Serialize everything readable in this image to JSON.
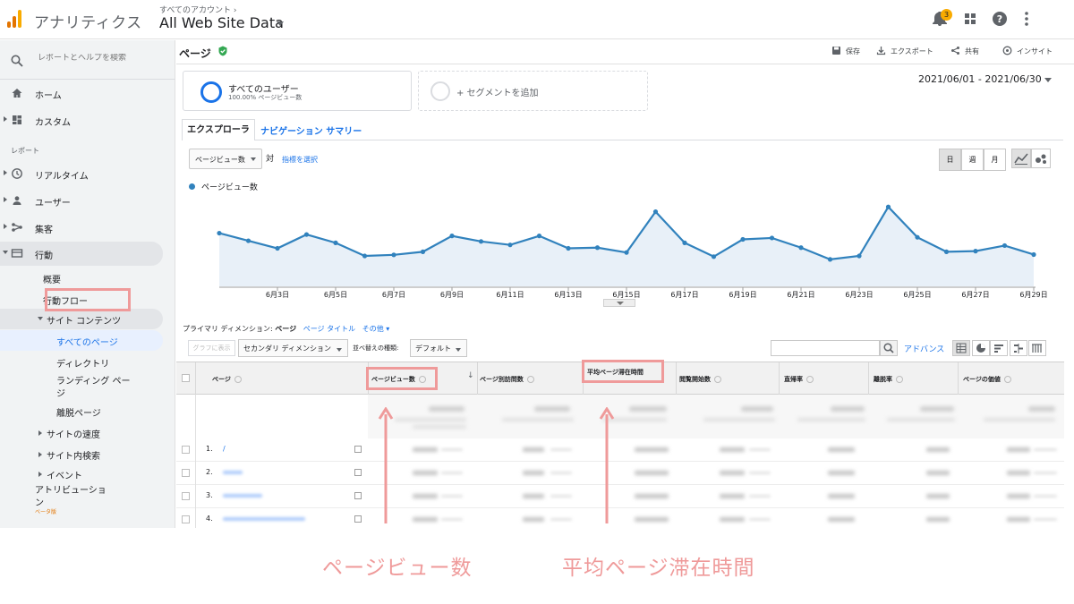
{
  "topbar": {
    "app_title": "アナリティクス",
    "account_crumb": "すべてのアカウント ›",
    "account_name": "All Web Site Data",
    "notification_count": "3",
    "icons": [
      "notifications-icon",
      "apps-icon",
      "help-icon",
      "more-vert-icon"
    ]
  },
  "sidebar": {
    "search_placeholder": "レポートとヘルプを検索",
    "items": [
      {
        "label": "ホーム",
        "icon": "home-icon"
      },
      {
        "label": "カスタム",
        "icon": "dashboard-icon"
      }
    ],
    "section_label": "レポート",
    "reports": [
      {
        "label": "リアルタイム",
        "icon": "clock-icon"
      },
      {
        "label": "ユーザー",
        "icon": "person-icon"
      },
      {
        "label": "集客",
        "icon": "acquisition-icon"
      },
      {
        "label": "行動",
        "icon": "behavior-icon"
      }
    ],
    "behavior_sub": {
      "overview": "概要",
      "flow": "行動フロー",
      "site_content": "サイト コンテンツ",
      "all_pages": "すべてのページ",
      "directory": "ディレクトリ",
      "landing_1": "ランディング ペー",
      "landing_2": "ジ",
      "exit_pages": "離脱ページ",
      "site_speed": "サイトの速度",
      "site_search": "サイト内検索",
      "events": "イベント"
    },
    "attribution_1": "アトリビューショ",
    "attribution_2": "ン",
    "beta": "ベータ版"
  },
  "header": {
    "page_title": "ページ",
    "tools": {
      "save": "保存",
      "export": "エクスポート",
      "share": "共有",
      "insight": "インサイト"
    }
  },
  "segment": {
    "name": "すべてのユーザー",
    "sub": "100.00% ページビュー数",
    "add": "+ セグメントを追加"
  },
  "date_range": "2021/06/01 - 2021/06/30",
  "tabs": {
    "explorer": "エクスプローラ",
    "nav_summary": "ナビゲーション サマリー"
  },
  "chart_controls": {
    "metric": "ページビュー数",
    "vs": "対",
    "select_metric": "指標を選択",
    "day": "日",
    "week": "週",
    "month": "月"
  },
  "chart_data": {
    "type": "area",
    "legend": "ページビュー数",
    "x": [
      "6月1日",
      "6月2日",
      "6月3日",
      "6月4日",
      "6月5日",
      "6月6日",
      "6月7日",
      "6月8日",
      "6月9日",
      "6月10日",
      "6月11日",
      "6月12日",
      "6月13日",
      "6月14日",
      "6月15日",
      "6月16日",
      "6月17日",
      "6月18日",
      "6月19日",
      "6月20日",
      "6月21日",
      "6月22日",
      "6月23日",
      "6月24日",
      "6月25日",
      "6月26日",
      "6月27日",
      "6月28日",
      "6月29日",
      "6月30日"
    ],
    "tick_labels": [
      "6月3日",
      "6月5日",
      "6月7日",
      "6月9日",
      "6月11日",
      "6月13日",
      "6月15日",
      "6月17日",
      "6月19日",
      "6月21日",
      "6月23日",
      "6月25日",
      "6月27日",
      "6月29日"
    ],
    "values": [
      1005,
      950,
      895,
      995,
      935,
      840,
      848,
      870,
      985,
      945,
      920,
      985,
      895,
      900,
      865,
      1160,
      935,
      835,
      960,
      970,
      900,
      815,
      840,
      1195,
      975,
      870,
      875,
      915,
      850
    ],
    "ylim": [
      620,
      1300
    ],
    "color": "#3182bd",
    "fill": "#e8f0f8",
    "grid": false
  },
  "dimensions": {
    "label": "プライマリ ディメンション:",
    "current": "ページ",
    "alt1": "ページ タイトル",
    "other": "その他 ▾"
  },
  "table_controls": {
    "plot_rows": "グラフに表示",
    "secondary_dim": "セカンダリ ディメンション",
    "sort_label": "並べ替えの種類:",
    "sort_value": "デフォルト",
    "advanced": "アドバンス"
  },
  "table": {
    "columns": [
      "ページ",
      "ページビュー数",
      "ページ別訪問数",
      "平均ページ滞在時間",
      "閲覧開始数",
      "直帰率",
      "離脱率",
      "ページの価値"
    ],
    "rows": [
      {
        "num": "1.",
        "page": "/"
      },
      {
        "num": "2.",
        "page": ""
      },
      {
        "num": "3.",
        "page": ""
      },
      {
        "num": "4.",
        "page": ""
      }
    ]
  },
  "annotations": {
    "pageviews": "ページビュー数",
    "avg_time": "平均ページ滞在時間",
    "color": "#ef9a9a"
  }
}
